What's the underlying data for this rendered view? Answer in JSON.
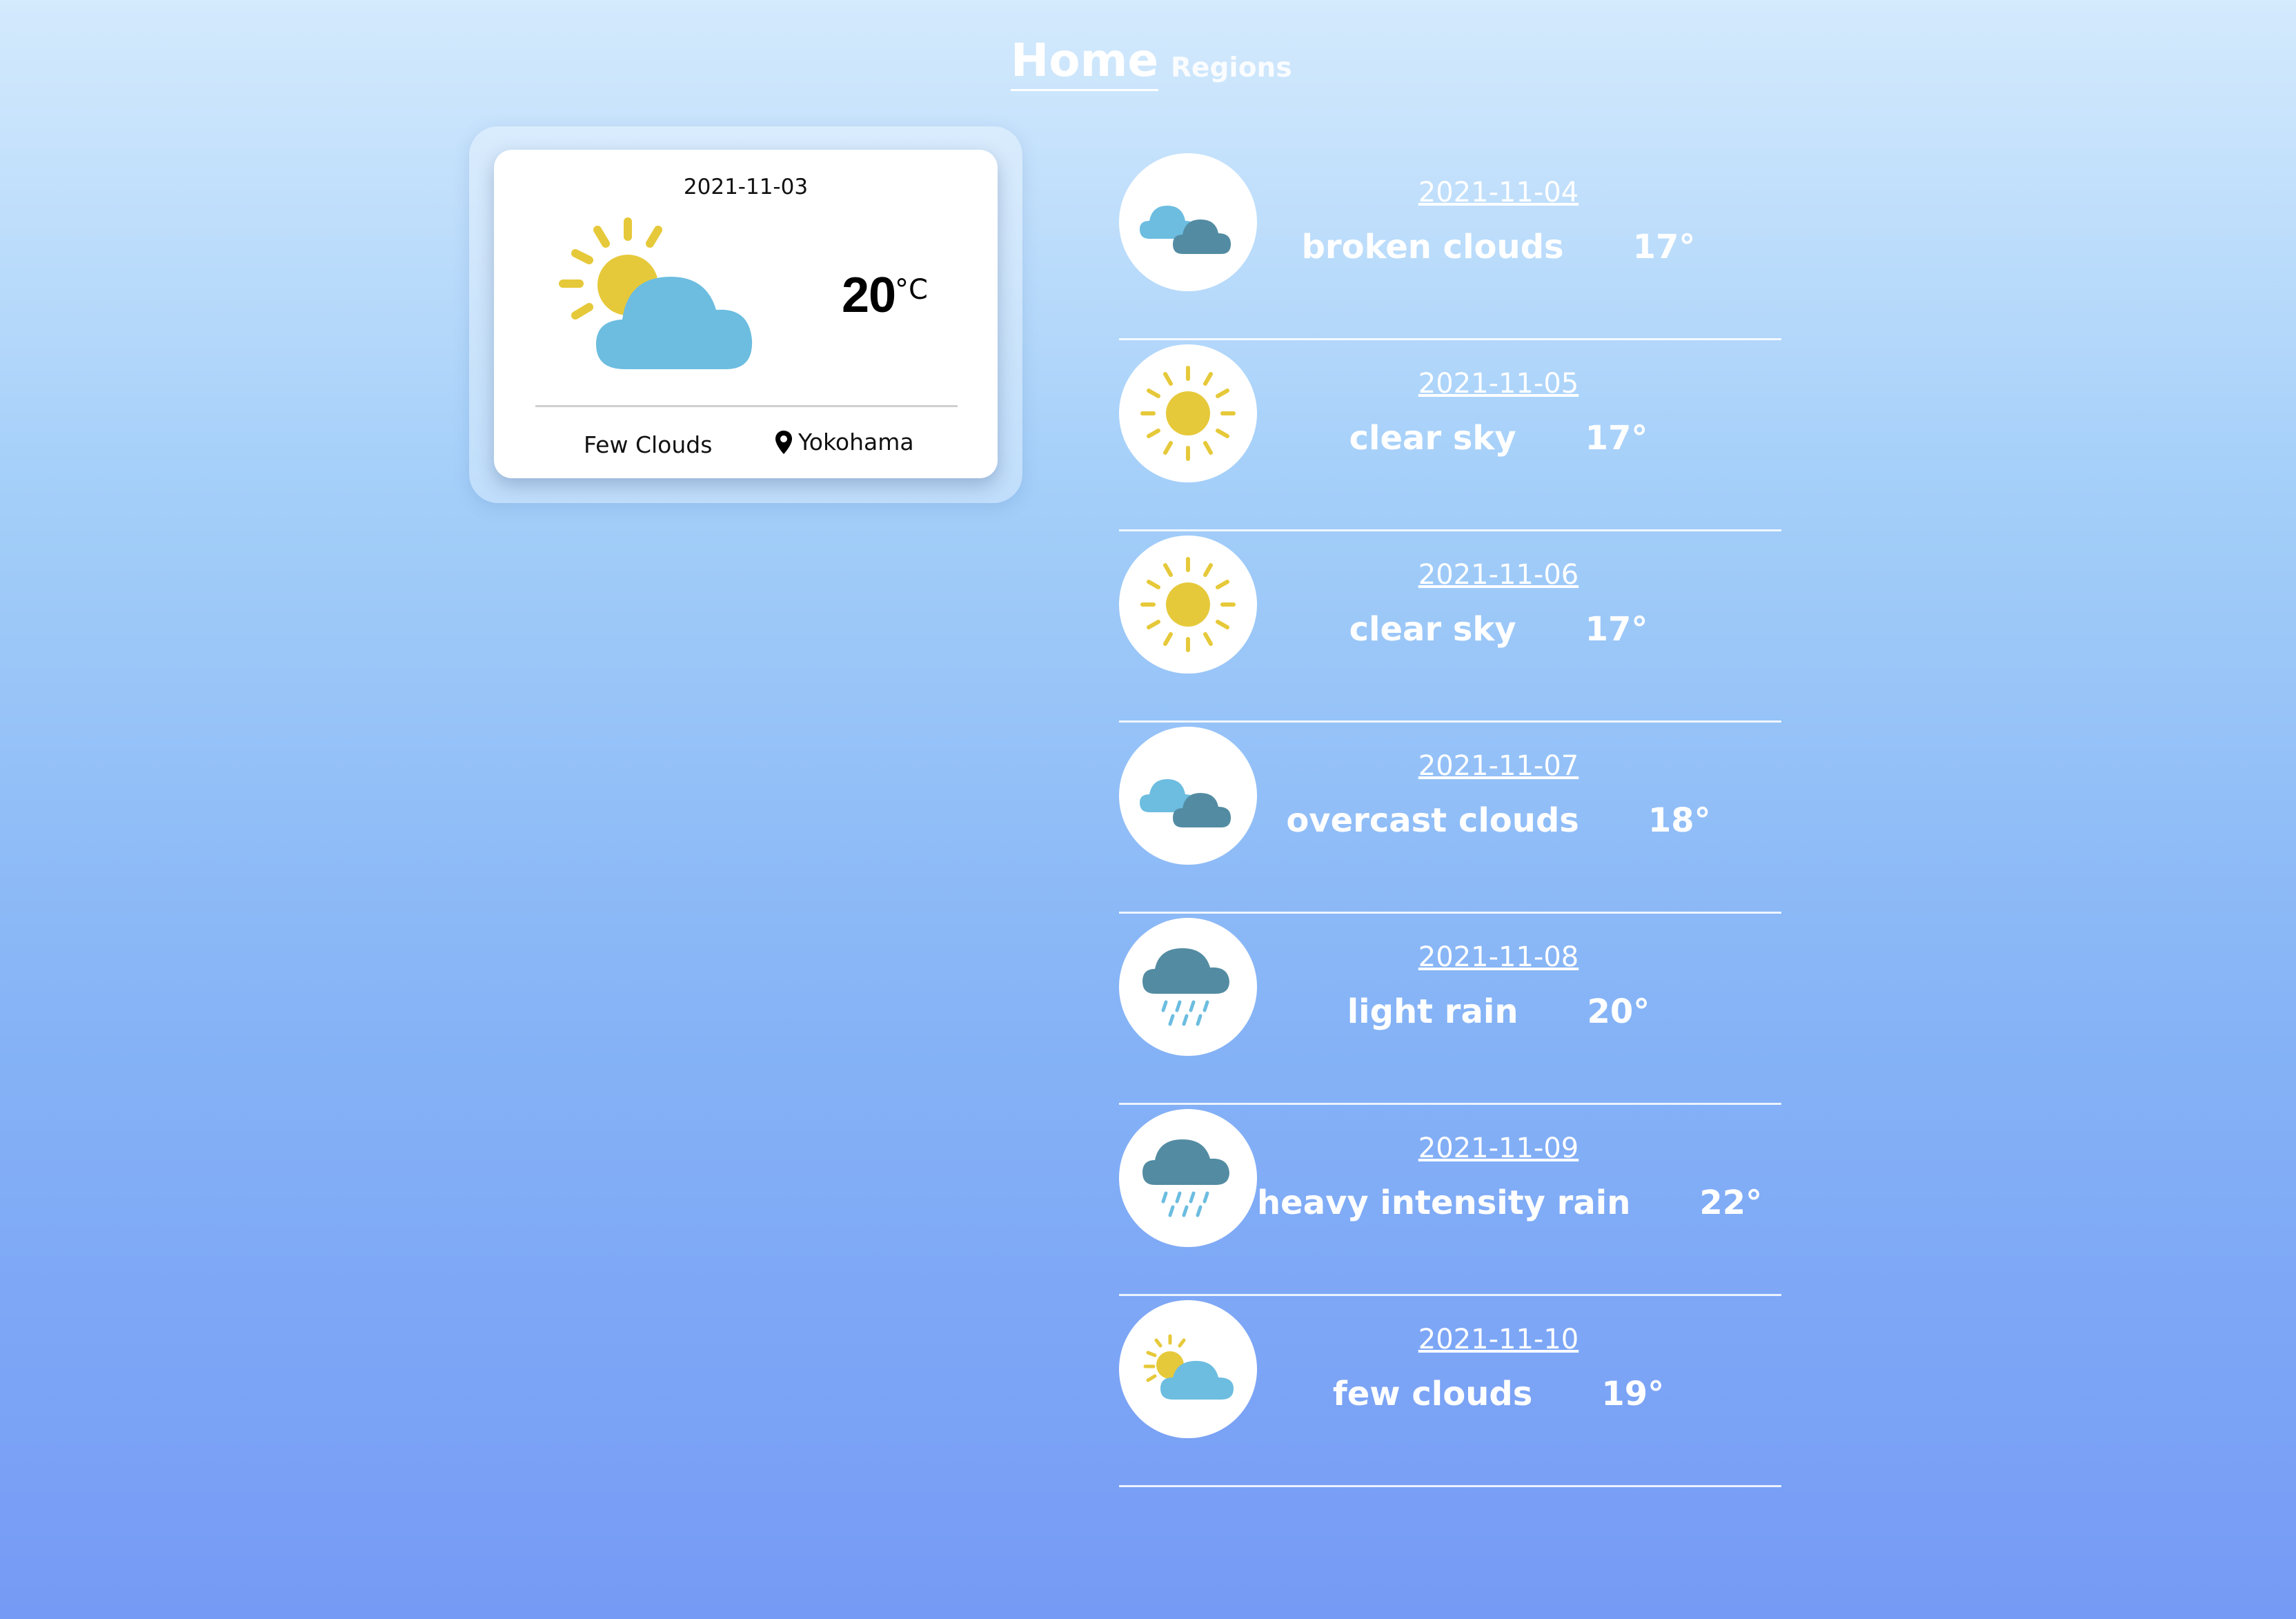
{
  "nav": {
    "home_label": "Home",
    "regions_label": "Regions"
  },
  "current": {
    "date": "2021-11-03",
    "temperature": "20",
    "unit": "°C",
    "description": "Few Clouds",
    "location": "Yokohama",
    "icon": "partly-cloudy-sun-icon"
  },
  "forecast": [
    {
      "date": "2021-11-04",
      "description": "broken clouds",
      "temp": "17°",
      "icon": "broken-clouds-icon"
    },
    {
      "date": "2021-11-05",
      "description": "clear sky",
      "temp": "17°",
      "icon": "sun-icon"
    },
    {
      "date": "2021-11-06",
      "description": "clear sky",
      "temp": "17°",
      "icon": "sun-icon"
    },
    {
      "date": "2021-11-07",
      "description": "overcast clouds",
      "temp": "18°",
      "icon": "overcast-clouds-icon"
    },
    {
      "date": "2021-11-08",
      "description": "light rain",
      "temp": "20°",
      "icon": "rain-cloud-icon"
    },
    {
      "date": "2021-11-09",
      "description": "heavy intensity rain",
      "temp": "22°",
      "icon": "rain-cloud-icon"
    },
    {
      "date": "2021-11-10",
      "description": "few clouds",
      "temp": "19°",
      "icon": "few-clouds-icon"
    }
  ],
  "colors": {
    "sun": "#e6c93a",
    "cloud_light": "#6cbde0",
    "cloud_dark": "#538ca2",
    "rain": "#6cbde0"
  }
}
